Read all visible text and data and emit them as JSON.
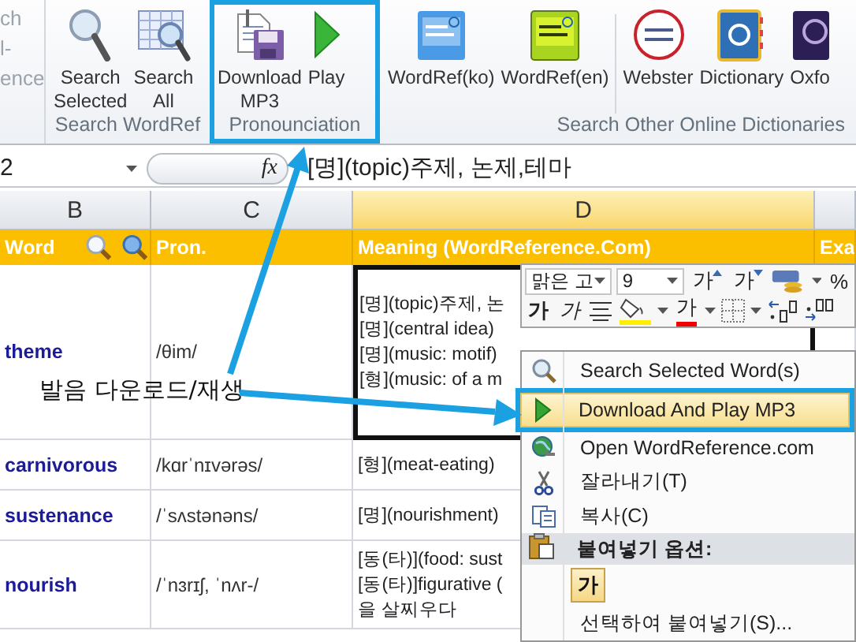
{
  "ribbon": {
    "cut_group": {
      "lines": [
        "ch",
        "l-",
        "ence"
      ]
    },
    "groups": [
      {
        "label": "Search WordRef",
        "highlighted": false,
        "buttons": [
          {
            "lines": [
              "Search",
              "Selected"
            ]
          },
          {
            "lines": [
              "Search",
              "All"
            ]
          }
        ]
      },
      {
        "label": "Pronounciation",
        "highlighted": true,
        "buttons": [
          {
            "lines": [
              "Download",
              "MP3"
            ]
          },
          {
            "lines": [
              "Play"
            ]
          }
        ]
      },
      {
        "label": "Search Other Online Dictionaries",
        "highlighted": false,
        "buttons": [
          {
            "lines": [
              "WordRef(ko)"
            ]
          },
          {
            "lines": [
              "WordRef(en)"
            ]
          },
          {
            "lines": [
              "Webster"
            ]
          },
          {
            "lines": [
              "Dictionary"
            ]
          },
          {
            "lines": [
              "Oxfo"
            ]
          }
        ]
      }
    ]
  },
  "formula_bar": {
    "name_box": "2",
    "function_label": "fx",
    "formula": "[명](topic)주제, 논제,테마"
  },
  "columns": [
    {
      "letter": "B",
      "selected": false
    },
    {
      "letter": "C",
      "selected": false
    },
    {
      "letter": "D",
      "selected": true
    }
  ],
  "header_row": {
    "word": "Word",
    "pron": "Pron.",
    "meaning": "Meaning (WordReference.Com)",
    "column_4": "Exa"
  },
  "rows": [
    {
      "word": "theme",
      "pron": "/θim/",
      "meaning": [
        "[명](topic)주제, 논",
        "[명](central idea)",
        "[명](music: motif)",
        "[형](music: of a m"
      ],
      "selected": true
    },
    {
      "word": "carnivorous",
      "pron": "/kɑrˈnɪvərəs/",
      "meaning": [
        "[형](meat-eating)"
      ],
      "selected": false
    },
    {
      "word": "sustenance",
      "pron": "/ˈsʌstənəns/",
      "meaning": [
        "[명](nourishment)"
      ],
      "selected": false
    },
    {
      "word": "nourish",
      "pron": "/ˈnɜrɪʃ, ˈnʌr-/",
      "meaning": [
        "[동(타)](food: sust",
        "[동(타)]figurative (",
        "을 살찌우다"
      ],
      "selected": false
    }
  ],
  "annotation": {
    "text": "발음 다운로드/재생"
  },
  "mini_toolbar": {
    "font": "맑은 고",
    "size": "9",
    "row_1": [
      {
        "kind": "grow",
        "label": "가"
      },
      {
        "kind": "shrink",
        "label": "가"
      },
      {
        "kind": "accounting"
      },
      {
        "kind": "caret"
      },
      {
        "kind": "percent",
        "label": "%"
      }
    ],
    "row_2": [
      {
        "kind": "bold",
        "label": "가"
      },
      {
        "kind": "italic",
        "label": "가"
      },
      {
        "kind": "align"
      },
      {
        "kind": "fill"
      },
      {
        "kind": "caret"
      },
      {
        "kind": "font-color",
        "label": "가"
      },
      {
        "kind": "caret"
      },
      {
        "kind": "borders"
      },
      {
        "kind": "caret"
      },
      {
        "kind": "inc-decimal"
      },
      {
        "kind": "dec-decimal"
      }
    ]
  },
  "context_menu": {
    "items": [
      {
        "kind": "item",
        "label": "Search Selected Word(s)",
        "selected": false,
        "highlighted": false
      },
      {
        "kind": "item",
        "label": "Download And Play MP3",
        "selected": true,
        "highlighted": true
      },
      {
        "kind": "item",
        "label": "Open WordReference.com",
        "selected": false,
        "highlighted": false
      },
      {
        "kind": "item",
        "label": "잘라내기(T)",
        "selected": false,
        "highlighted": false
      },
      {
        "kind": "item",
        "label": "복사(C)",
        "selected": false,
        "highlighted": false
      },
      {
        "kind": "header",
        "label": "붙여넣기 옵션:"
      },
      {
        "kind": "paste-option",
        "label": "가",
        "selected": false
      },
      {
        "kind": "item",
        "label": "선택하여 붙여넣기(S)...",
        "selected": false,
        "highlighted": false
      }
    ]
  }
}
